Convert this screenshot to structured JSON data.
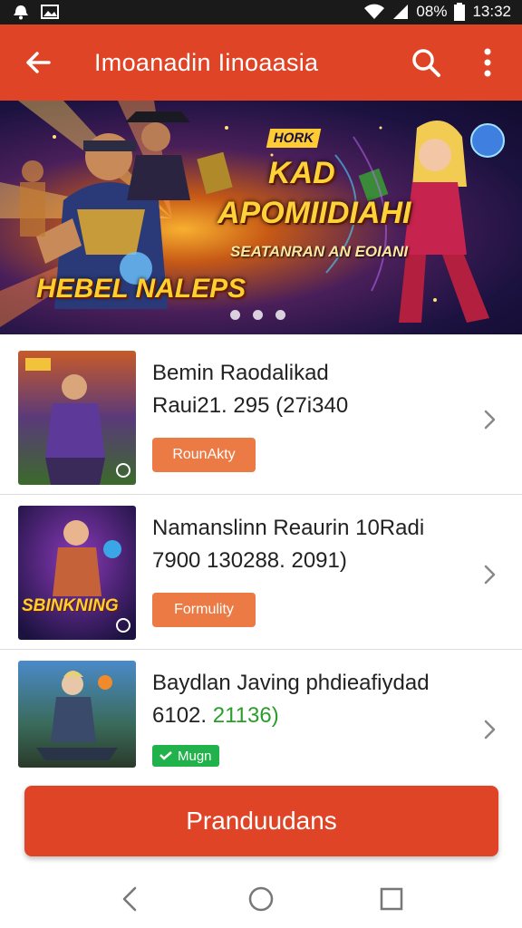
{
  "status_bar": {
    "battery": "08%",
    "time": "13:32",
    "icons": [
      "notification-icon",
      "image-icon",
      "wifi-icon",
      "signal-icon",
      "battery-icon"
    ]
  },
  "app_bar": {
    "title": "Imoanadin Iinoaasia",
    "icons": [
      "back-arrow-icon",
      "search-icon",
      "more-vert-icon"
    ],
    "color": "#e04427"
  },
  "banner": {
    "badge": "HORK",
    "title_line1": "KAD",
    "title_line2": "APOMIIDIAHI",
    "subtitle": "SEATANRAN AN EOIANI",
    "brand": "HEBEL NALEPS",
    "dots": 3
  },
  "items": [
    {
      "title": "Bemin Raodalikad",
      "meta": "Raui21. 295 (27i340",
      "tag": "RounAkty",
      "tag_style": "orange"
    },
    {
      "title": "Namanslinn Reaurin 10Radi",
      "meta": "7900 130288. 2091)",
      "tag": "Formulity",
      "tag_style": "orange",
      "thumb_text": "SBINKNING"
    },
    {
      "title": "Baydlan Javing phdieafiydad",
      "meta_prefix": "6102. ",
      "meta_green": "21136)",
      "tag": "Mugn",
      "tag_style": "green"
    }
  ],
  "cta": {
    "label": "Pranduudans"
  },
  "nav": {
    "icons": [
      "nav-back-icon",
      "nav-home-icon",
      "nav-recents-icon"
    ]
  },
  "colors": {
    "accent": "#e04427",
    "tag_orange": "#ec7a45",
    "tag_green": "#22b24c"
  }
}
